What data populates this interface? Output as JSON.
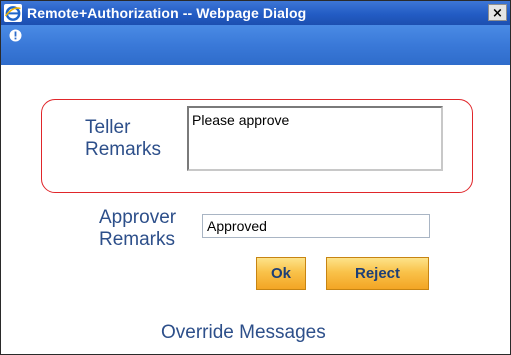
{
  "window": {
    "title": "Remote+Authorization -- Webpage Dialog",
    "close_label": "×"
  },
  "infobar": {
    "icon": "info-icon"
  },
  "teller": {
    "label_line1": "Teller",
    "label_line2": "Remarks",
    "value": "Please approve"
  },
  "approver": {
    "label_line1": "Approver",
    "label_line2": "Remarks",
    "value": "Approved"
  },
  "buttons": {
    "ok_label": "Ok",
    "reject_label": "Reject"
  },
  "override": {
    "label": "Override Messages"
  },
  "colors": {
    "titlebar": "#235cc4",
    "infobar": "#3a79d8",
    "highlight_border": "#e0262a",
    "label_text": "#2d4f8a",
    "button_fill": "#f9c24a"
  }
}
